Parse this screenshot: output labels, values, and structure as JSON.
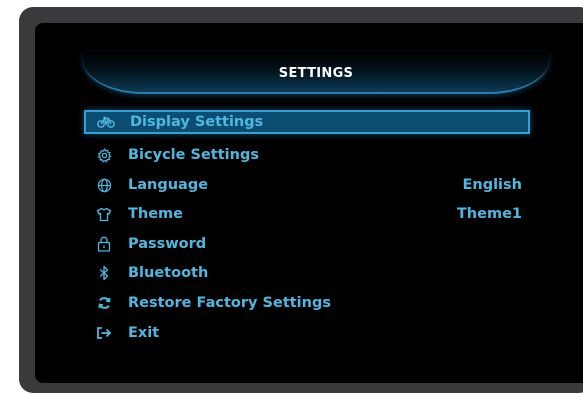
{
  "header": {
    "title": "SETTINGS"
  },
  "menu": {
    "items": [
      {
        "label": "Display Settings",
        "icon": "bicycle-icon"
      },
      {
        "label": "Bicycle Settings",
        "icon": "gear-icon"
      },
      {
        "label": "Language",
        "value": "English",
        "icon": "globe-icon"
      },
      {
        "label": "Theme",
        "value": "Theme1",
        "icon": "shirt-icon"
      },
      {
        "label": "Password",
        "icon": "lock-icon"
      },
      {
        "label": "Bluetooth",
        "icon": "bluetooth-icon"
      },
      {
        "label": "Restore Factory Settings",
        "icon": "restore-icon"
      },
      {
        "label": "Exit",
        "icon": "exit-icon"
      }
    ],
    "selected_index": 0
  },
  "colors": {
    "text": "#4fb8e0",
    "selected_bg": "#0b4e72",
    "selected_border": "#35a0d8",
    "header_title": "#ffffff",
    "screen_bg": "#000000"
  }
}
